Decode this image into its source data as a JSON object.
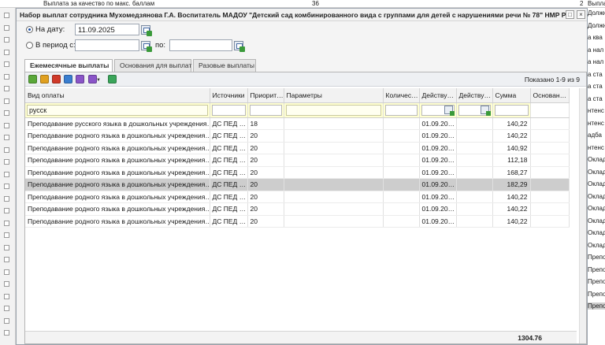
{
  "background": {
    "top_row": {
      "label": "Выплата за качество по макс. баллам",
      "value": "36",
      "right_num": "2",
      "right_text": "Выпла"
    },
    "right_column": [
      "Должн",
      "Должн",
      "а ква",
      "а нал",
      "а нал",
      "а ста",
      "а ста",
      "а ста",
      "нтенс",
      "нтенс",
      "адба",
      "нтенс",
      "Оклад",
      "Оклад",
      "Оклад",
      "Оклад",
      "Оклад",
      "Оклад",
      "Оклад",
      "Оклад",
      "Препо",
      "Препо",
      "Препо",
      "Препо",
      "Препо"
    ]
  },
  "dialog": {
    "title": "Набор выплат сотрудника Мухомедзянова Г.А. Воспитатель МАДОУ \"Детский сад комбинированного вида с группами для детей с нарушениями речи № 78\" НМР РТ",
    "maximize_symbol": "□",
    "close_symbol": "×"
  },
  "filters": {
    "on_date_label": "На дату:",
    "on_date_value": "11.09.2025",
    "period_label": "В период с:",
    "period_from": "",
    "period_to_label": "по:",
    "period_to": "",
    "selected": "on_date"
  },
  "tabs": [
    {
      "label": "Ежемесячные выплаты",
      "active": true
    },
    {
      "label": "Основания для выплат",
      "active": false
    },
    {
      "label": "Разовые выплаты",
      "active": false
    }
  ],
  "toolbar": {
    "shown_text": "Показано 1-9 из 9",
    "buttons": [
      {
        "name": "add-icon",
        "color": "#5aa83a"
      },
      {
        "name": "edit-icon",
        "color": "#e0a020"
      },
      {
        "name": "delete-icon",
        "color": "#d03a2a"
      },
      {
        "name": "copy-icon",
        "color": "#3a7ed0"
      },
      {
        "name": "sum-icon",
        "color": "#8a55c8"
      },
      {
        "name": "actions-icon",
        "color": "#8a55c8"
      },
      {
        "name": "refresh-icon",
        "color": "#3aa55a"
      }
    ]
  },
  "grid": {
    "columns": [
      "Вид оплаты",
      "Источники",
      "Приорит…",
      "Параметры",
      "Количес…",
      "Действу…",
      "Действу…",
      "Сумма",
      "Основан…"
    ],
    "filter": {
      "vid": "русск"
    },
    "rows": [
      {
        "vid": "Преподавание русского языка в дошкольных учреждения…",
        "src": "ДС ПЕД …",
        "pri": "18",
        "from": "01.09.20…",
        "sum": "140,22",
        "selected": false
      },
      {
        "vid": "Преподавание родного языка в дошкольных учреждения…",
        "src": "ДС ПЕД …",
        "pri": "20",
        "from": "01.09.20…",
        "sum": "140,22",
        "selected": false
      },
      {
        "vid": "Преподавание родного языка в дошкольных учреждения…",
        "src": "ДС ПЕД …",
        "pri": "20",
        "from": "01.09.20…",
        "sum": "140,92",
        "selected": false
      },
      {
        "vid": "Преподавание родного языка в дошкольных учреждения…",
        "src": "ДС ПЕД …",
        "pri": "20",
        "from": "01.09.20…",
        "sum": "112,18",
        "selected": false
      },
      {
        "vid": "Преподавание родного языка в дошкольных учреждения…",
        "src": "ДС ПЕД …",
        "pri": "20",
        "from": "01.09.20…",
        "sum": "168,27",
        "selected": false
      },
      {
        "vid": "Преподавание родного языка в дошкольных учреждения…",
        "src": "ДС ПЕД …",
        "pri": "20",
        "from": "01.09.20…",
        "sum": "182,29",
        "selected": true
      },
      {
        "vid": "Преподавание родного языка в дошкольных учреждения…",
        "src": "ДС ПЕД …",
        "pri": "20",
        "from": "01.09.20…",
        "sum": "140,22",
        "selected": false
      },
      {
        "vid": "Преподавание родного языка в дошкольных учреждения…",
        "src": "ДС ПЕД …",
        "pri": "20",
        "from": "01.09.20…",
        "sum": "140,22",
        "selected": false
      },
      {
        "vid": "Преподавание родного языка в дошкольных учреждения…",
        "src": "ДС ПЕД …",
        "pri": "20",
        "from": "01.09.20…",
        "sum": "140,22",
        "selected": false
      }
    ],
    "total": "1304.76"
  }
}
